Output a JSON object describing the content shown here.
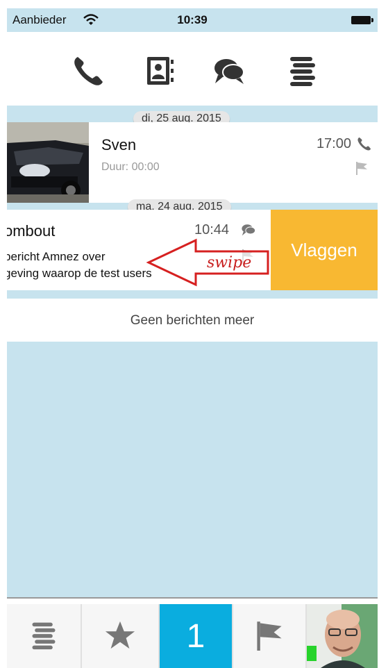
{
  "status_bar": {
    "carrier": "Aanbieder",
    "time": "10:39"
  },
  "top_nav": {
    "icons": [
      "phone-icon",
      "contacts-icon",
      "chat-icon",
      "timeline-icon"
    ]
  },
  "list": {
    "items": [
      {
        "date": "di, 25 aug. 2015",
        "name": "Sven",
        "time": "17:00",
        "subtitle": "Duur: 00:00",
        "type_icon": "phone-icon",
        "flag_icon": "flag-icon"
      },
      {
        "date": "ma, 24 aug. 2015",
        "name": "ombout",
        "time": "10:44",
        "preview_line1": "bericht Amnez over",
        "preview_line2": "geving waarop de test users",
        "type_icon": "chat-icon",
        "flag_icon": "flag-icon"
      }
    ],
    "swipe_action_label": "Vlaggen",
    "swipe_hint": "swipe",
    "end_message": "Geen berichten meer"
  },
  "tab_bar": {
    "tabs": [
      {
        "name": "timeline",
        "icon": "timeline-icon"
      },
      {
        "name": "favorites",
        "icon": "star-icon"
      },
      {
        "name": "counter",
        "label": "1"
      },
      {
        "name": "flagged",
        "icon": "flag-icon"
      },
      {
        "name": "profile",
        "icon": "avatar"
      }
    ]
  },
  "colors": {
    "accent_blue": "#0aaddf",
    "action_orange": "#f8b832",
    "list_background": "#c7e3ee",
    "swipe_arrow": "#d62020"
  }
}
